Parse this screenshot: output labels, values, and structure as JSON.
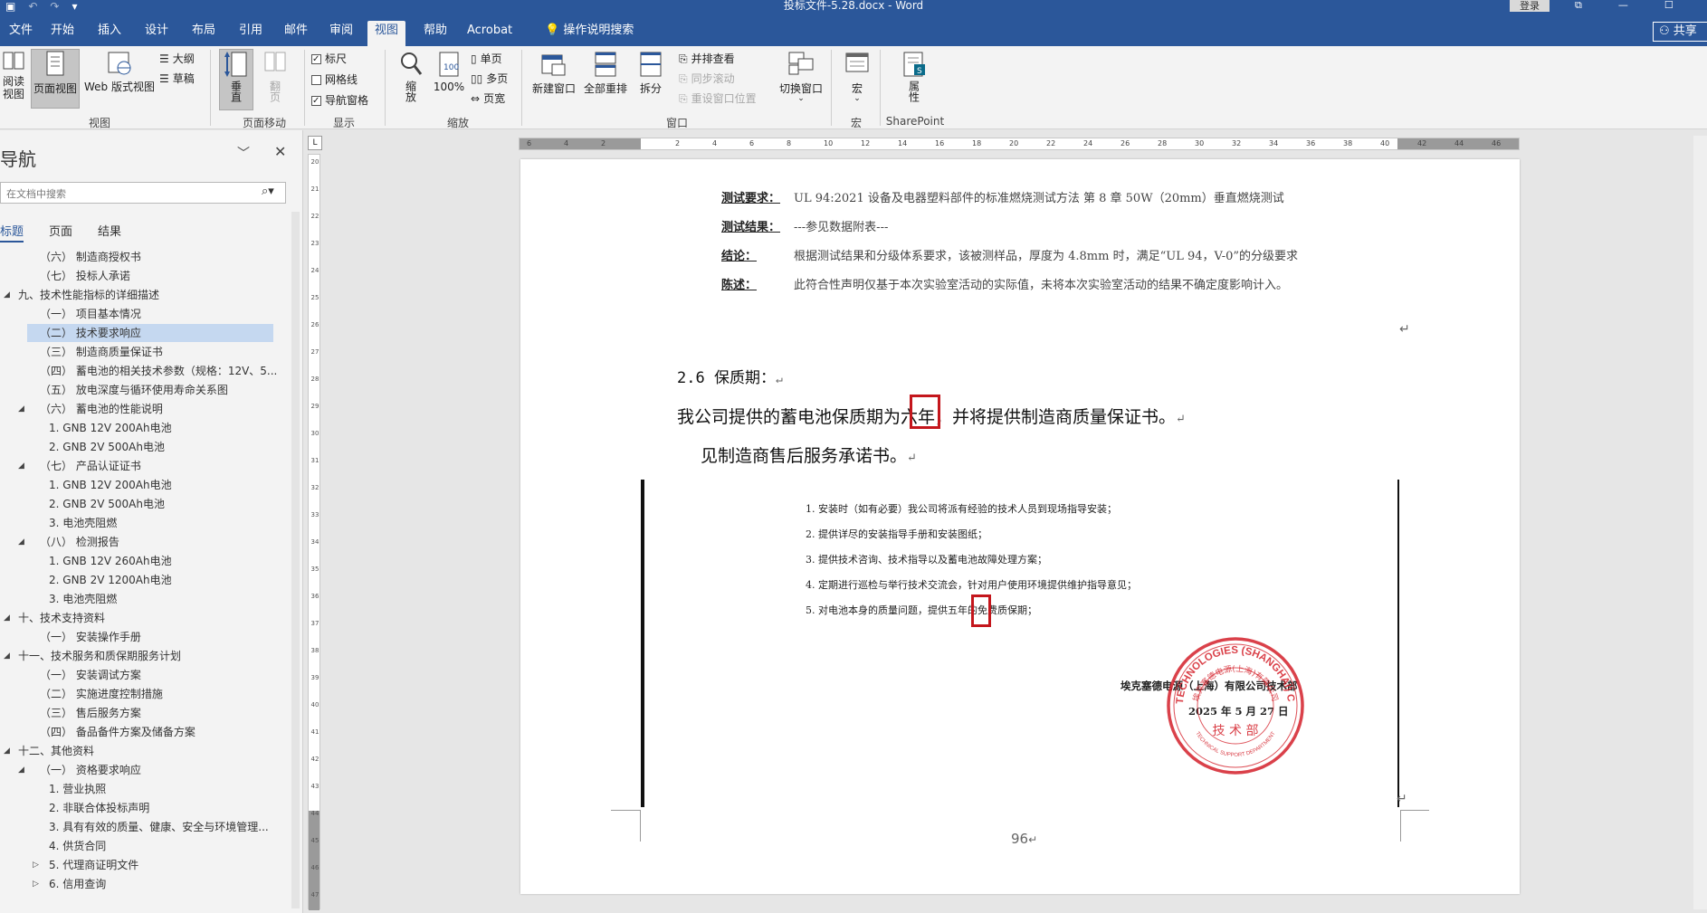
{
  "titlebar": {
    "title": "投标文件-5.28.docx - Word",
    "signin": "登录"
  },
  "menu": {
    "tabs": [
      "文件",
      "开始",
      "插入",
      "设计",
      "布局",
      "引用",
      "邮件",
      "审阅",
      "视图",
      "帮助",
      "Acrobat",
      "操作说明搜索"
    ],
    "active_index": 8,
    "share": "共享"
  },
  "ribbon": {
    "read_mode": "阅读\n视图",
    "print_layout": "页面视图",
    "web_layout": "Web 版式视图",
    "outline": "大纲",
    "draft": "草稿",
    "views_group": "视图",
    "vertical": "垂直",
    "side_to_side": "翻页",
    "page_move_group": "页面移动",
    "ruler": "标尺",
    "gridlines": "网格线",
    "nav_pane": "导航窗格",
    "show_group": "显示",
    "zoom": "缩放",
    "zoom_100": "100%",
    "one_page": "单页",
    "multi_page": "多页",
    "page_width": "页宽",
    "zoom_group": "缩放",
    "new_window": "新建窗口",
    "arrange_all": "全部重排",
    "split": "拆分",
    "side_by_side": "并排查看",
    "sync_scroll": "同步滚动",
    "reset_pos": "重设窗口位置",
    "switch_window": "切换窗口",
    "window_group": "窗口",
    "macros": "宏",
    "macros_group": "宏",
    "properties": "属性",
    "sharepoint_group": "SharePoint"
  },
  "nav": {
    "title": "导航",
    "search_placeholder": "在文档中搜索",
    "tabs": [
      "标题",
      "页面",
      "结果"
    ],
    "items": [
      {
        "text": "（六） 制造商授权书",
        "level": 2,
        "exp": ""
      },
      {
        "text": "（七） 投标人承诺",
        "level": 2,
        "exp": ""
      },
      {
        "text": "九、技术性能指标的详细描述",
        "level": 1,
        "exp": "open"
      },
      {
        "text": "（一） 项目基本情况",
        "level": 2,
        "exp": ""
      },
      {
        "text": "（二） 技术要求响应",
        "level": 2,
        "exp": "",
        "selected": true
      },
      {
        "text": "（三） 制造商质量保证书",
        "level": 2,
        "exp": ""
      },
      {
        "text": "（四） 蓄电池的相关技术参数（规格：12V、5...",
        "level": 2,
        "exp": ""
      },
      {
        "text": "（五） 放电深度与循环使用寿命关系图",
        "level": 2,
        "exp": ""
      },
      {
        "text": "（六） 蓄电池的性能说明",
        "level": 2,
        "exp": "open"
      },
      {
        "text": "1. GNB 12V 200Ah电池",
        "level": 3,
        "exp": ""
      },
      {
        "text": "2. GNB 2V 500Ah电池",
        "level": 3,
        "exp": ""
      },
      {
        "text": "（七） 产品认证证书",
        "level": 2,
        "exp": "open"
      },
      {
        "text": "1. GNB 12V 200Ah电池",
        "level": 3,
        "exp": ""
      },
      {
        "text": "2. GNB 2V 500Ah电池",
        "level": 3,
        "exp": ""
      },
      {
        "text": "3. 电池壳阻燃",
        "level": 3,
        "exp": ""
      },
      {
        "text": "（八） 检测报告",
        "level": 2,
        "exp": "open"
      },
      {
        "text": "1. GNB 12V 260Ah电池",
        "level": 3,
        "exp": ""
      },
      {
        "text": "2. GNB 2V 1200Ah电池",
        "level": 3,
        "exp": ""
      },
      {
        "text": "3. 电池壳阻燃",
        "level": 3,
        "exp": ""
      },
      {
        "text": "十、技术支持资料",
        "level": 1,
        "exp": "open"
      },
      {
        "text": "（一） 安装操作手册",
        "level": 2,
        "exp": ""
      },
      {
        "text": "十一、技术服务和质保期服务计划",
        "level": 1,
        "exp": "open"
      },
      {
        "text": "（一） 安装调试方案",
        "level": 2,
        "exp": ""
      },
      {
        "text": "（二） 实施进度控制措施",
        "level": 2,
        "exp": ""
      },
      {
        "text": "（三） 售后服务方案",
        "level": 2,
        "exp": ""
      },
      {
        "text": "（四） 备品备件方案及储备方案",
        "level": 2,
        "exp": ""
      },
      {
        "text": "十二、其他资料",
        "level": 1,
        "exp": "open"
      },
      {
        "text": "（一） 资格要求响应",
        "level": 2,
        "exp": "open"
      },
      {
        "text": "1. 营业执照",
        "level": 3,
        "exp": ""
      },
      {
        "text": "2. 非联合体投标声明",
        "level": 3,
        "exp": ""
      },
      {
        "text": "3. 具有有效的质量、健康、安全与环境管理...",
        "level": 3,
        "exp": ""
      },
      {
        "text": "4. 供货合同",
        "level": 3,
        "exp": ""
      },
      {
        "text": "5. 代理商证明文件",
        "level": 3,
        "exp": "closed"
      },
      {
        "text": "6. 信用查询",
        "level": 3,
        "exp": "closed"
      }
    ]
  },
  "doc": {
    "test": [
      {
        "label": "测试要求：",
        "value": "UL 94:2021 设备及电器塑料部件的标准燃烧测试方法  第 8 章 50W（20mm）垂直燃烧测试"
      },
      {
        "label": "测试结果：",
        "value": "---参见数据附表---"
      },
      {
        "label": "结论：",
        "value": "根据测试结果和分级体系要求，该被测样品，厚度为 4.8mm 时，满足“UL 94，V-0”的分级要求"
      },
      {
        "label": "陈述：",
        "value": "此符合性声明仅基于本次实验室活动的实际值，未将本次实验室活动的结果不确定度影响计入。"
      }
    ],
    "heading": "2.6  保质期：",
    "para1": "我公司提供的蓄电池保质期为六年，并将提供制造商质量保证书。",
    "para2": "见制造商售后服务承诺书。",
    "scan_items": [
      "1.  安装时（如有必要）我公司将派有经验的技术人员到现场指导安装；",
      "2.  提供详尽的安装指导手册和安装图纸；",
      "3.  提供技术咨询、技术指导以及蓄电池故障处理方案；",
      "4.  定期进行巡检与举行技术交流会，针对用户使用环境提供维护指导意见；",
      "5.  对电池本身的质量问题，提供五年的免费质保期；"
    ],
    "company": "埃克塞德电源（上海）有限公司技术部",
    "date": "2025 年 5 月 27 日",
    "seal_outer": "EXIDE TECHNOLOGIES (SHANGHAI) CO.,LTD.",
    "seal_inner": "埃克塞德电源(上海)有限公司",
    "seal_center": "技 术 部",
    "seal_bottom": "TECHNICAL SUPPORT DEPARTMENT",
    "page_number": "96"
  },
  "colors": {
    "word_blue": "#2b579a",
    "highlight_red": "#c4161c",
    "seal_red": "#d4202a",
    "nav_selected": "#c5d8f0"
  }
}
